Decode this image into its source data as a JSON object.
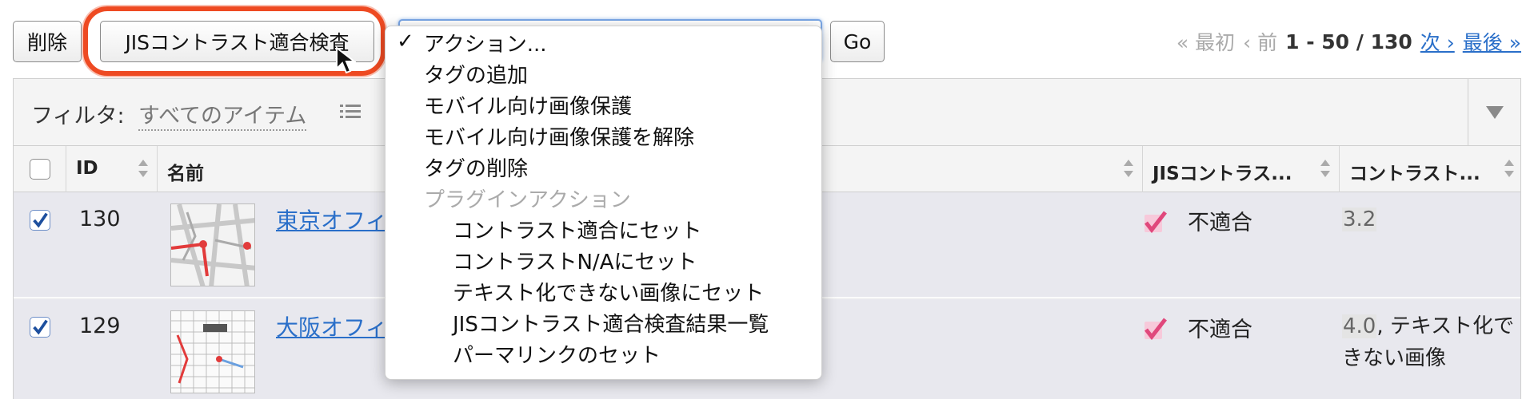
{
  "toolbar": {
    "delete_label": "削除",
    "jis_check_label": "JISコントラスト適合検査",
    "go_label": "Go"
  },
  "pager": {
    "first": "« 最初",
    "prev": "‹ 前",
    "range": "1 - 50 / 130",
    "next": "次 ›",
    "last": "最後 »"
  },
  "filter": {
    "label": "フィルタ:",
    "value": "すべてのアイテム"
  },
  "table": {
    "headers": {
      "id": "ID",
      "name": "名前",
      "jis": "JISコントラス...",
      "contrast": "コントラスト..."
    },
    "rows": [
      {
        "checked": true,
        "id": "130",
        "name": "東京オフィ",
        "jis_status": "不適合",
        "contrast_value": "3.2",
        "contrast_note": ""
      },
      {
        "checked": true,
        "id": "129",
        "name": "大阪オフィ",
        "jis_status": "不適合",
        "contrast_value": "4.0",
        "contrast_note": ", テキスト化できない画像"
      }
    ]
  },
  "action_menu": {
    "selected_check": "✓",
    "items": [
      {
        "label": "アクション...",
        "type": "selected"
      },
      {
        "label": "タグの追加",
        "type": "item"
      },
      {
        "label": "モバイル向け画像保護",
        "type": "item"
      },
      {
        "label": "モバイル向け画像保護を解除",
        "type": "item"
      },
      {
        "label": "タグの削除",
        "type": "item"
      },
      {
        "label": "プラグインアクション",
        "type": "group"
      },
      {
        "label": "コントラスト適合にセット",
        "type": "sub"
      },
      {
        "label": "コントラストN/Aにセット",
        "type": "sub"
      },
      {
        "label": "テキスト化できない画像にセット",
        "type": "sub"
      },
      {
        "label": "JISコントラスト適合検査結果一覧",
        "type": "sub"
      },
      {
        "label": "パーマリンクのセット",
        "type": "sub"
      }
    ]
  },
  "colors": {
    "highlight": "#ee4a22",
    "link": "#2a6fc9",
    "check_pink": "#e0487c"
  },
  "icons": {
    "cursor": "arrow-cursor-icon",
    "list": "list-icon",
    "sort": "sort-arrows-icon",
    "filter_toggle": "triangle-down-icon",
    "status": "pink-check-icon"
  }
}
